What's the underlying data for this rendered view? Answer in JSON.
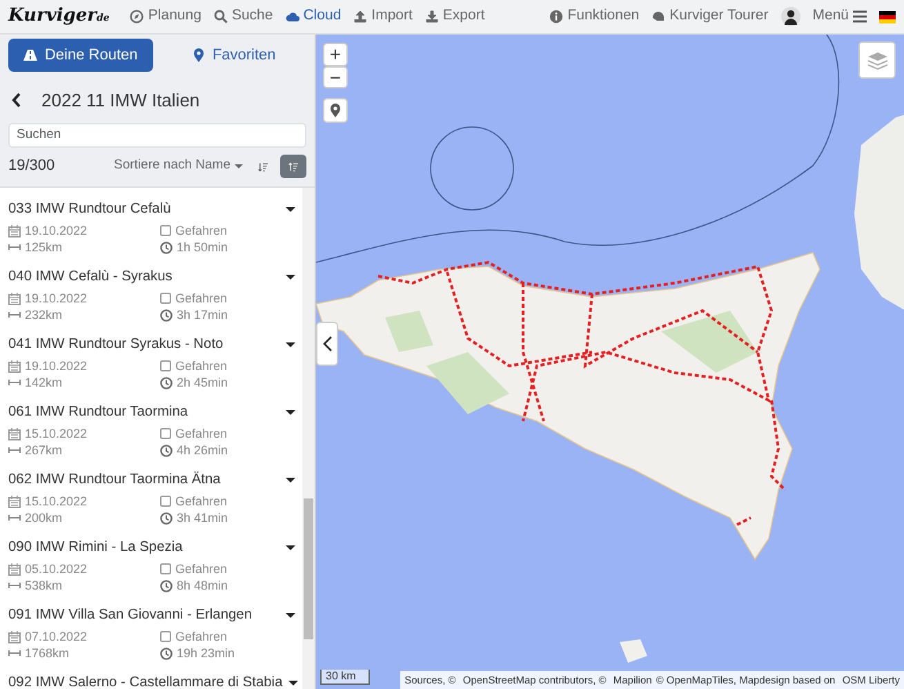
{
  "navbar": {
    "logo": "Kurviger",
    "logo_suffix": "de",
    "items": [
      {
        "label": "Planung",
        "selected": false
      },
      {
        "label": "Suche",
        "selected": false
      },
      {
        "label": "Cloud",
        "selected": true
      },
      {
        "label": "Import",
        "selected": false
      },
      {
        "label": "Export",
        "selected": false
      }
    ],
    "right_items": [
      {
        "label": "Funktionen"
      },
      {
        "label": "Kurviger Tourer"
      }
    ],
    "menu_label": "Menü"
  },
  "sidebar": {
    "tabs": [
      {
        "label": "Deine Routen",
        "selected": true
      },
      {
        "label": "Favoriten",
        "selected": false
      }
    ],
    "folder_title": "2022 11 IMW Italien",
    "search": {
      "placeholder": "Suchen"
    },
    "count": "19/300",
    "sort_label": "Sortiere nach Name",
    "sort_buttons": [
      {
        "kind": "descending",
        "selected": false
      },
      {
        "kind": "ascending",
        "selected": true
      }
    ],
    "routes": [
      {
        "title": "033 IMW Rundtour Cefalù",
        "date": "19.10.2022",
        "driven_label": "Gefahren",
        "checked": false,
        "distance": "125km",
        "duration": "1h 50min"
      },
      {
        "title": "040 IMW Cefalù - Syrakus",
        "date": "19.10.2022",
        "driven_label": "Gefahren",
        "checked": false,
        "distance": "232km",
        "duration": "3h 17min"
      },
      {
        "title": "041 IMW Rundtour Syrakus - Noto",
        "date": "19.10.2022",
        "driven_label": "Gefahren",
        "checked": false,
        "distance": "142km",
        "duration": "2h 45min"
      },
      {
        "title": "061 IMW Rundtour Taormina",
        "date": "15.10.2022",
        "driven_label": "Gefahren",
        "checked": false,
        "distance": "267km",
        "duration": "4h 26min"
      },
      {
        "title": "062 IMW Rundtour Taormina Ätna",
        "date": "15.10.2022",
        "driven_label": "Gefahren",
        "checked": false,
        "distance": "200km",
        "duration": "3h 41min"
      },
      {
        "title": "090 IMW Rimini - La Spezia",
        "date": "05.10.2022",
        "driven_label": "Gefahren",
        "checked": false,
        "distance": "538km",
        "duration": "8h 48min"
      },
      {
        "title": "091 IMW Villa San Giovanni - Erlangen",
        "date": "07.10.2022",
        "driven_label": "Gefahren",
        "checked": false,
        "distance": "1768km",
        "duration": "19h 23min"
      },
      {
        "title": "092 IMW Salerno - Castellammare di Stabia"
      }
    ]
  },
  "map": {
    "zoom_in": "+",
    "zoom_out": "−",
    "scale": "30 km",
    "attribution": [
      {
        "text": "Sources",
        "kind": "link"
      },
      {
        "text": ", © ",
        "kind": "text"
      },
      {
        "text": "OpenStreetMap",
        "kind": "link"
      },
      {
        "text": " contributors, © ",
        "kind": "text"
      },
      {
        "text": "Mapilion",
        "kind": "link"
      },
      {
        "text": "© OpenMapTiles",
        "kind": "link"
      },
      {
        "text": ", Mapdesign based on ",
        "kind": "text"
      },
      {
        "text": "OSM Liberty",
        "kind": "link"
      }
    ]
  }
}
